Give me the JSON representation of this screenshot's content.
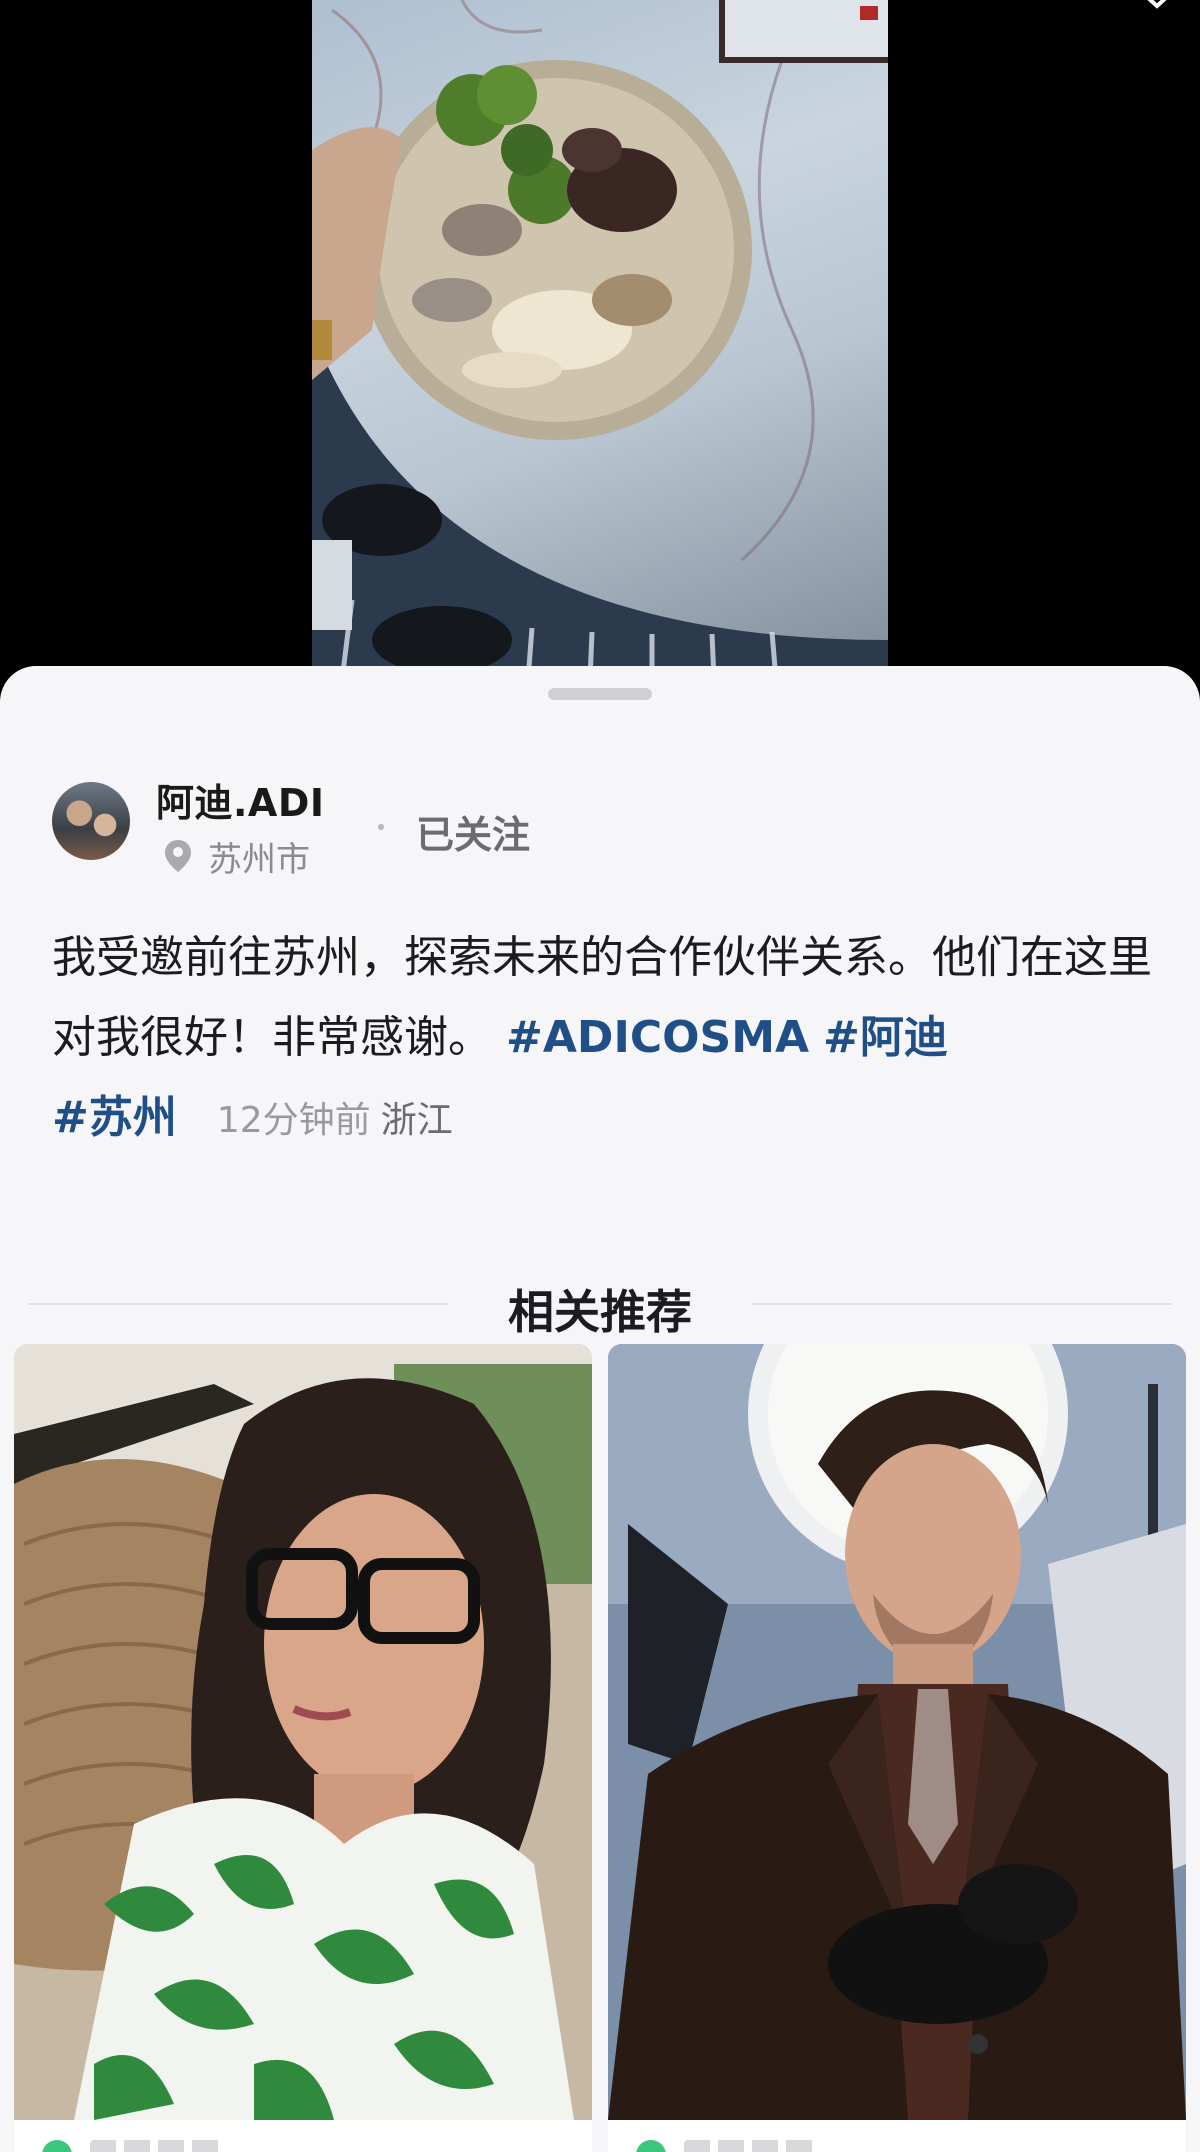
{
  "video": {
    "description_icons": [
      "more-icon"
    ]
  },
  "post": {
    "author": {
      "name": "阿迪.ADI",
      "location": "苏州市",
      "follow_status": "已关注"
    },
    "text": "我受邀前往苏州，探索未来的合作伙伴关系。他们在这里对我很好！非常感谢。",
    "hashtags": [
      "#ADICOSMA",
      "#阿迪",
      "#苏州"
    ],
    "time_ago": "12分钟前",
    "region": "浙江"
  },
  "recommendations": {
    "title": "相关推荐",
    "cards": [
      {
        "icon": "woman-glasses-photo"
      },
      {
        "icon": "man-suit-photo"
      }
    ]
  },
  "colors": {
    "hashtag": "#1f4f86",
    "sheet_bg": "#f6f6f8",
    "muted_text": "#8a8a8f"
  }
}
